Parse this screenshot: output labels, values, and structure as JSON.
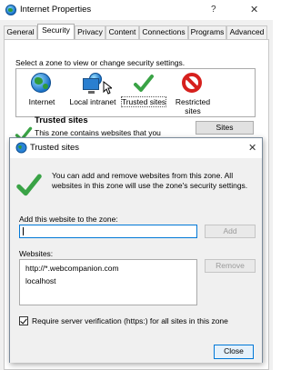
{
  "parent_window": {
    "title": "Internet Properties",
    "help_symbol": "?",
    "close_symbol": "✕",
    "icon": "internet-globe-icon",
    "tabs": [
      {
        "label": "General"
      },
      {
        "label": "Security"
      },
      {
        "label": "Privacy"
      },
      {
        "label": "Content"
      },
      {
        "label": "Connections"
      },
      {
        "label": "Programs"
      },
      {
        "label": "Advanced"
      }
    ],
    "active_tab": "Security",
    "zone_prompt": "Select a zone to view or change security settings.",
    "zones": [
      {
        "label": "Internet",
        "icon": "globe-icon"
      },
      {
        "label": "Local intranet",
        "icon": "intranet-icon"
      },
      {
        "label": "Trusted sites",
        "icon": "checkmark-icon"
      },
      {
        "label": "Restricted sites",
        "icon": "restricted-icon"
      }
    ],
    "selected_zone": "Trusted sites",
    "zone_heading": "Trusted sites",
    "zone_description": "This zone contains websites that you",
    "sites_button": "Sites"
  },
  "dialog": {
    "title": "Trusted sites",
    "close_symbol": "✕",
    "description": "You can add and remove websites from this zone. All websites in this zone will use the zone's security settings.",
    "add_label": "Add this website to the zone:",
    "add_value": "",
    "add_button": "Add",
    "websites_label": "Websites:",
    "websites": [
      "http://*.webcompanion.com",
      "localhost"
    ],
    "remove_button": "Remove",
    "verification_label": "Require server verification (https:) for all sites in this zone",
    "verification_checked": true,
    "close_button": "Close"
  },
  "colors": {
    "accent": "#0078d7",
    "check_green": "#3aa346",
    "restricted_red": "#d6201d"
  }
}
